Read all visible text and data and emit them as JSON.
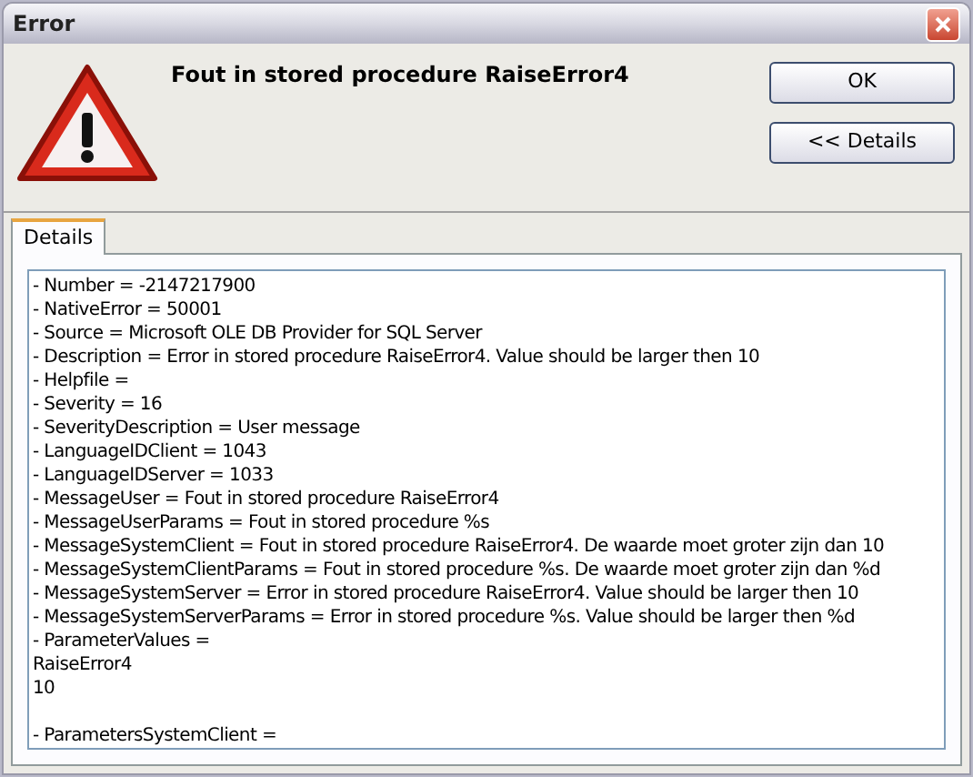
{
  "window": {
    "title": "Error"
  },
  "heading": "Fout in stored procedure RaiseError4",
  "buttons": [
    "OK",
    "<< Details"
  ],
  "tabs": [
    {
      "label": "Details",
      "selected": true
    }
  ],
  "details_blocks": [
    [
      "- Number = -2147217900",
      "- NativeError = 50001",
      "- Source = Microsoft OLE DB Provider for SQL Server",
      "- Description = Error in stored procedure RaiseError4. Value should be larger then 10",
      "- Helpfile =",
      "- Severity = 16",
      "- SeverityDescription = User message",
      "- LanguageIDClient = 1043",
      "- LanguageIDServer = 1033",
      "- MessageUser = Fout in stored procedure RaiseError4",
      "- MessageUserParams = Fout in stored procedure %s",
      "- MessageSystemClient = Fout in stored procedure RaiseError4. De waarde moet groter zijn dan 10",
      "- MessageSystemClientParams = Fout in stored procedure %s. De waarde moet groter zijn dan %d",
      "- MessageSystemServer = Error in stored procedure RaiseError4. Value should be larger then 10",
      "- MessageSystemServerParams = Error in stored procedure %s. Value should be larger then %d",
      "- ParameterValues =",
      "RaiseError4",
      "10"
    ],
    [
      "- ParametersSystemClient ="
    ]
  ]
}
